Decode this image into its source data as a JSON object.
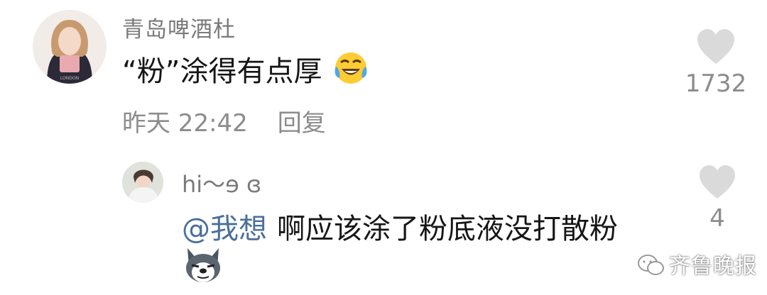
{
  "comment": {
    "username": "青岛啤酒杜",
    "text": "“粉”涂得有点厚",
    "emoji": "face-with-tears-of-joy-icon",
    "time": "昨天 22:42",
    "reply_label": "回复",
    "like_count": "1732"
  },
  "reply": {
    "username": "hi～ɘ ɞ",
    "mention": "@我想",
    "text": "啊应该涂了粉底液没打散粉",
    "emoji": "husky-dog-sticker-icon",
    "like_count": "4"
  },
  "watermark": {
    "text": "齐鲁晚报",
    "icon": "wechat-icon"
  },
  "colors": {
    "username": "#7a7a7a",
    "meta": "#8c8c8c",
    "mention": "#4a6f9c",
    "heart": "#dadada"
  }
}
